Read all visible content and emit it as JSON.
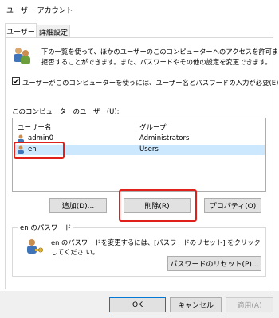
{
  "window": {
    "title": "ユーザー アカウント"
  },
  "tabs": [
    {
      "label": "ユーザー",
      "active": true
    },
    {
      "label": "詳細設定",
      "active": false
    }
  ],
  "intro": {
    "line1": "下の一覧を使って、ほかのユーザーのこのコンピューターへのアクセスを許可または",
    "line2": "拒否することができます。また、パスワードやその他の設定を変更できます。"
  },
  "require_login": {
    "checked": true,
    "label": "ユーザーがこのコンピューターを使うには、ユーザー名とパスワードの入力が必要(E)"
  },
  "users_section": {
    "label": "このコンピューターのユーザー(U):",
    "columns": [
      "ユーザー名",
      "グループ"
    ],
    "rows": [
      {
        "name": "admin0",
        "group": "Administrators",
        "selected": false
      },
      {
        "name": "en",
        "group": "Users",
        "selected": true
      }
    ]
  },
  "user_buttons": {
    "add": "追加(D)...",
    "remove": "削除(R)",
    "properties": "プロパティ(O)"
  },
  "password_group": {
    "title": "en のパスワード",
    "text": "en のパスワードを変更するには、[パスワードのリセット] をクリックしてくださ い。",
    "reset_button": "パスワードのリセット(P)..."
  },
  "dialog_buttons": {
    "ok": "OK",
    "cancel": "キャンセル",
    "apply": "適用(A)"
  },
  "colors": {
    "highlight": "#e0201b",
    "selection": "#cce8ff",
    "window_bg": "#ffffff"
  }
}
